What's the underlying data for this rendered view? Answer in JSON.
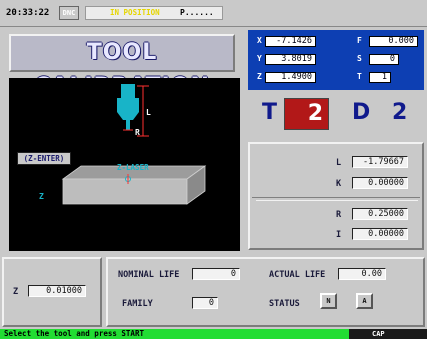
{
  "topbar": {
    "time": "20:33:22",
    "mode": "DNC",
    "status": "IN POSITION",
    "program": "P......"
  },
  "title": "TOOL CALIBRATION",
  "graphic": {
    "length_label": "L",
    "radius_label": "R",
    "probe_label": "Z-LASER",
    "z_axis_label": "Z"
  },
  "coords": {
    "x_label": "X",
    "x_value": "-7.1426",
    "y_label": "Y",
    "y_value": "3.8019",
    "z_label": "Z",
    "z_value": "1.4900",
    "f_label": "F",
    "f_value": "0.000",
    "s_label": "S",
    "s_value": "0",
    "t_label": "T",
    "t_value": "1"
  },
  "tool": {
    "t_letter": "T",
    "t_value": "2",
    "d_letter": "D",
    "d_value": "2"
  },
  "calibration": {
    "button_label": "(Z-ENTER)",
    "l_label": "L",
    "l_value": "-1.79667",
    "k_label": "K",
    "k_value": "0.00000",
    "r_label": "R",
    "r_value": "0.25000",
    "i_label": "I",
    "i_value": "0.00000"
  },
  "bottom": {
    "z_label": "Z",
    "z_value": "0.01000",
    "nominal_life_label": "NOMINAL LIFE",
    "nominal_life_value": "0",
    "actual_life_label": "ACTUAL LIFE",
    "actual_life_value": "0.00",
    "family_label": "FAMILY",
    "family_value": "0",
    "status_label": "STATUS",
    "status_n": "N",
    "status_a": "A"
  },
  "footer": {
    "message": "Select the tool and press START",
    "indicator": "CAP"
  },
  "colors": {
    "coord_panel": "#0d3fb3",
    "tool_highlight": "#b21818",
    "footer_ok": "#22dd33",
    "probe_cyan": "#18b4c8"
  }
}
